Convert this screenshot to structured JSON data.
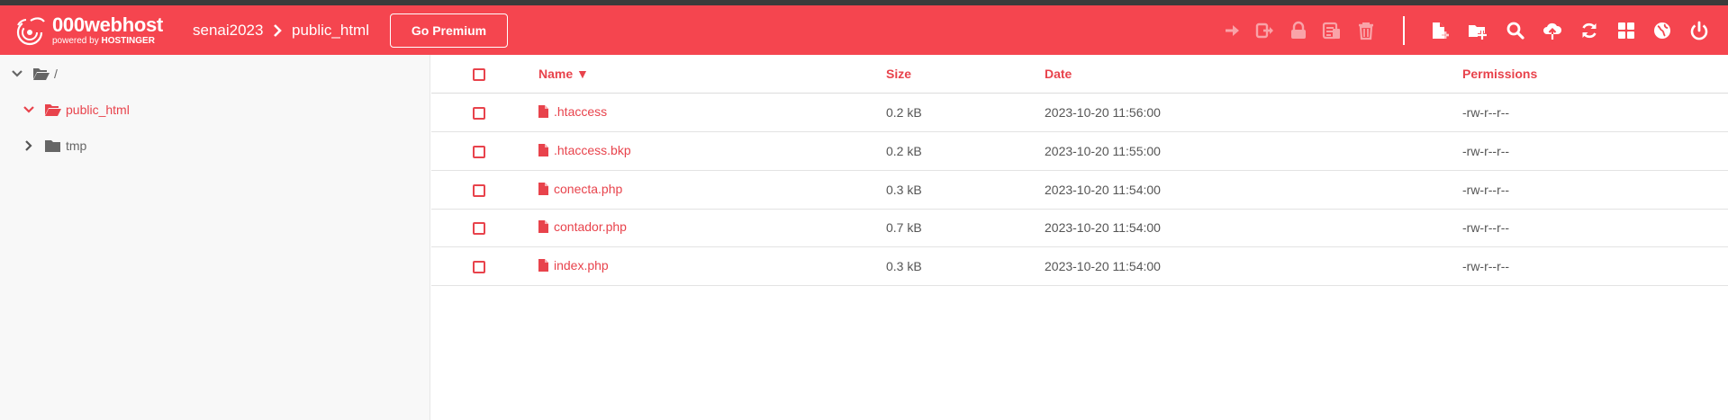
{
  "brand": {
    "name": "000webhost",
    "sub_prefix": "powered by",
    "sub_brand": "HOSTINGER"
  },
  "breadcrumb": {
    "site": "senai2023",
    "folder": "public_html"
  },
  "header": {
    "premium_label": "Go Premium"
  },
  "toolbar": {
    "disabled_icons": [
      "move-icon",
      "rename-icon",
      "lock-icon",
      "archive-icon",
      "trash-icon"
    ],
    "active_icons": [
      "new-file-icon",
      "new-folder-icon",
      "search-icon",
      "upload-icon",
      "refresh-icon",
      "grid-view-icon",
      "globe-icon",
      "power-icon"
    ]
  },
  "tree": {
    "root": "/",
    "items": [
      {
        "label": "public_html",
        "expanded": true,
        "active": true
      },
      {
        "label": "tmp",
        "expanded": false,
        "active": false
      }
    ]
  },
  "table": {
    "columns": {
      "name": "Name ▼",
      "size": "Size",
      "date": "Date",
      "permissions": "Permissions"
    },
    "rows": [
      {
        "name": ".htaccess",
        "size": "0.2 kB",
        "date": "2023-10-20 11:56:00",
        "perm": "-rw-r--r--"
      },
      {
        "name": ".htaccess.bkp",
        "size": "0.2 kB",
        "date": "2023-10-20 11:55:00",
        "perm": "-rw-r--r--"
      },
      {
        "name": "conecta.php",
        "size": "0.3 kB",
        "date": "2023-10-20 11:54:00",
        "perm": "-rw-r--r--"
      },
      {
        "name": "contador.php",
        "size": "0.7 kB",
        "date": "2023-10-20 11:54:00",
        "perm": "-rw-r--r--"
      },
      {
        "name": "index.php",
        "size": "0.3 kB",
        "date": "2023-10-20 11:54:00",
        "perm": "-rw-r--r--"
      }
    ]
  },
  "colors": {
    "accent": "#f5454f",
    "link": "#e8434c",
    "disabled_icon": "#f9a3a8",
    "text": "#555555"
  }
}
